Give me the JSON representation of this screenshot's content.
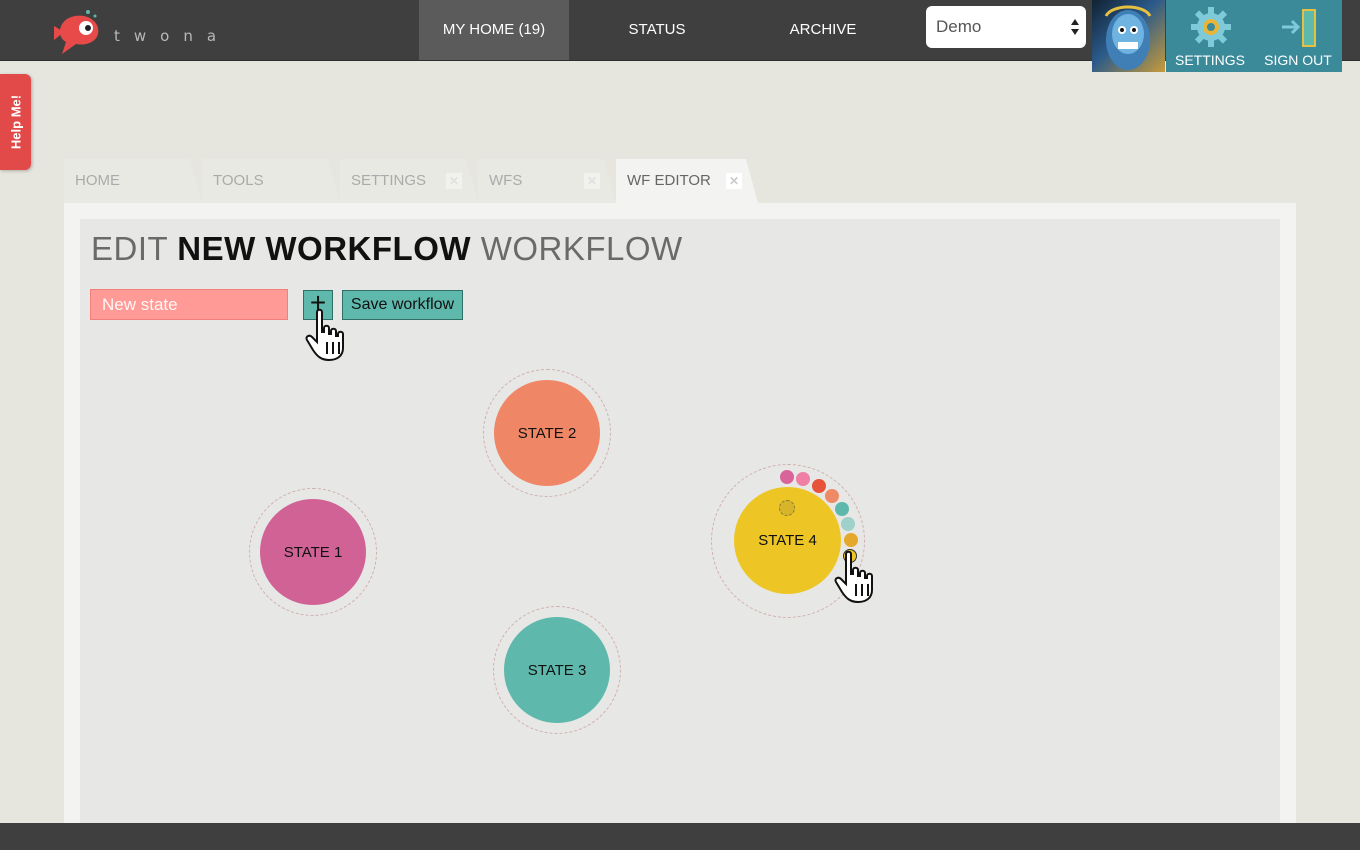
{
  "header": {
    "logo_text": "twona",
    "nav": [
      {
        "label": "MY HOME (19)",
        "active": true
      },
      {
        "label": "STATUS",
        "active": false
      },
      {
        "label": "ARCHIVE",
        "active": false
      }
    ],
    "environment_select": {
      "value": "Demo"
    },
    "settings_label": "SETTINGS",
    "signout_label": "SIGN OUT"
  },
  "help_tab": {
    "label": "Help Me!"
  },
  "tabs": [
    {
      "label": "HOME",
      "closable": false,
      "active": false
    },
    {
      "label": "TOOLS",
      "closable": false,
      "active": false
    },
    {
      "label": "SETTINGS",
      "closable": true,
      "active": false
    },
    {
      "label": "WFS",
      "closable": true,
      "active": false
    },
    {
      "label": "WF EDITOR",
      "closable": true,
      "active": true
    }
  ],
  "tab_close_glyph": "✕",
  "editor": {
    "title_prefix": "EDIT ",
    "title_name": "NEW WORKFLOW",
    "title_suffix": " WORKFLOW",
    "state_input_placeholder": "New state",
    "add_button_glyph": "+",
    "save_label": "Save workflow"
  },
  "states": [
    {
      "label": "STATE 1",
      "color": "#d06296"
    },
    {
      "label": "STATE 2",
      "color": "#ef8767"
    },
    {
      "label": "STATE 3",
      "color": "#5fb8ac"
    },
    {
      "label": "STATE 4",
      "color": "#edc625"
    }
  ],
  "color_options": [
    "#d9649a",
    "#f07fa6",
    "#e6533a",
    "#ef8a66",
    "#5fb8ac",
    "#9fd0ca",
    "#e4a92a",
    "#edc625"
  ],
  "colors": {
    "topbar": "#3f3f3f",
    "accent": "#5fb8ac",
    "help": "#e24a4a",
    "input": "#ff9a96"
  }
}
